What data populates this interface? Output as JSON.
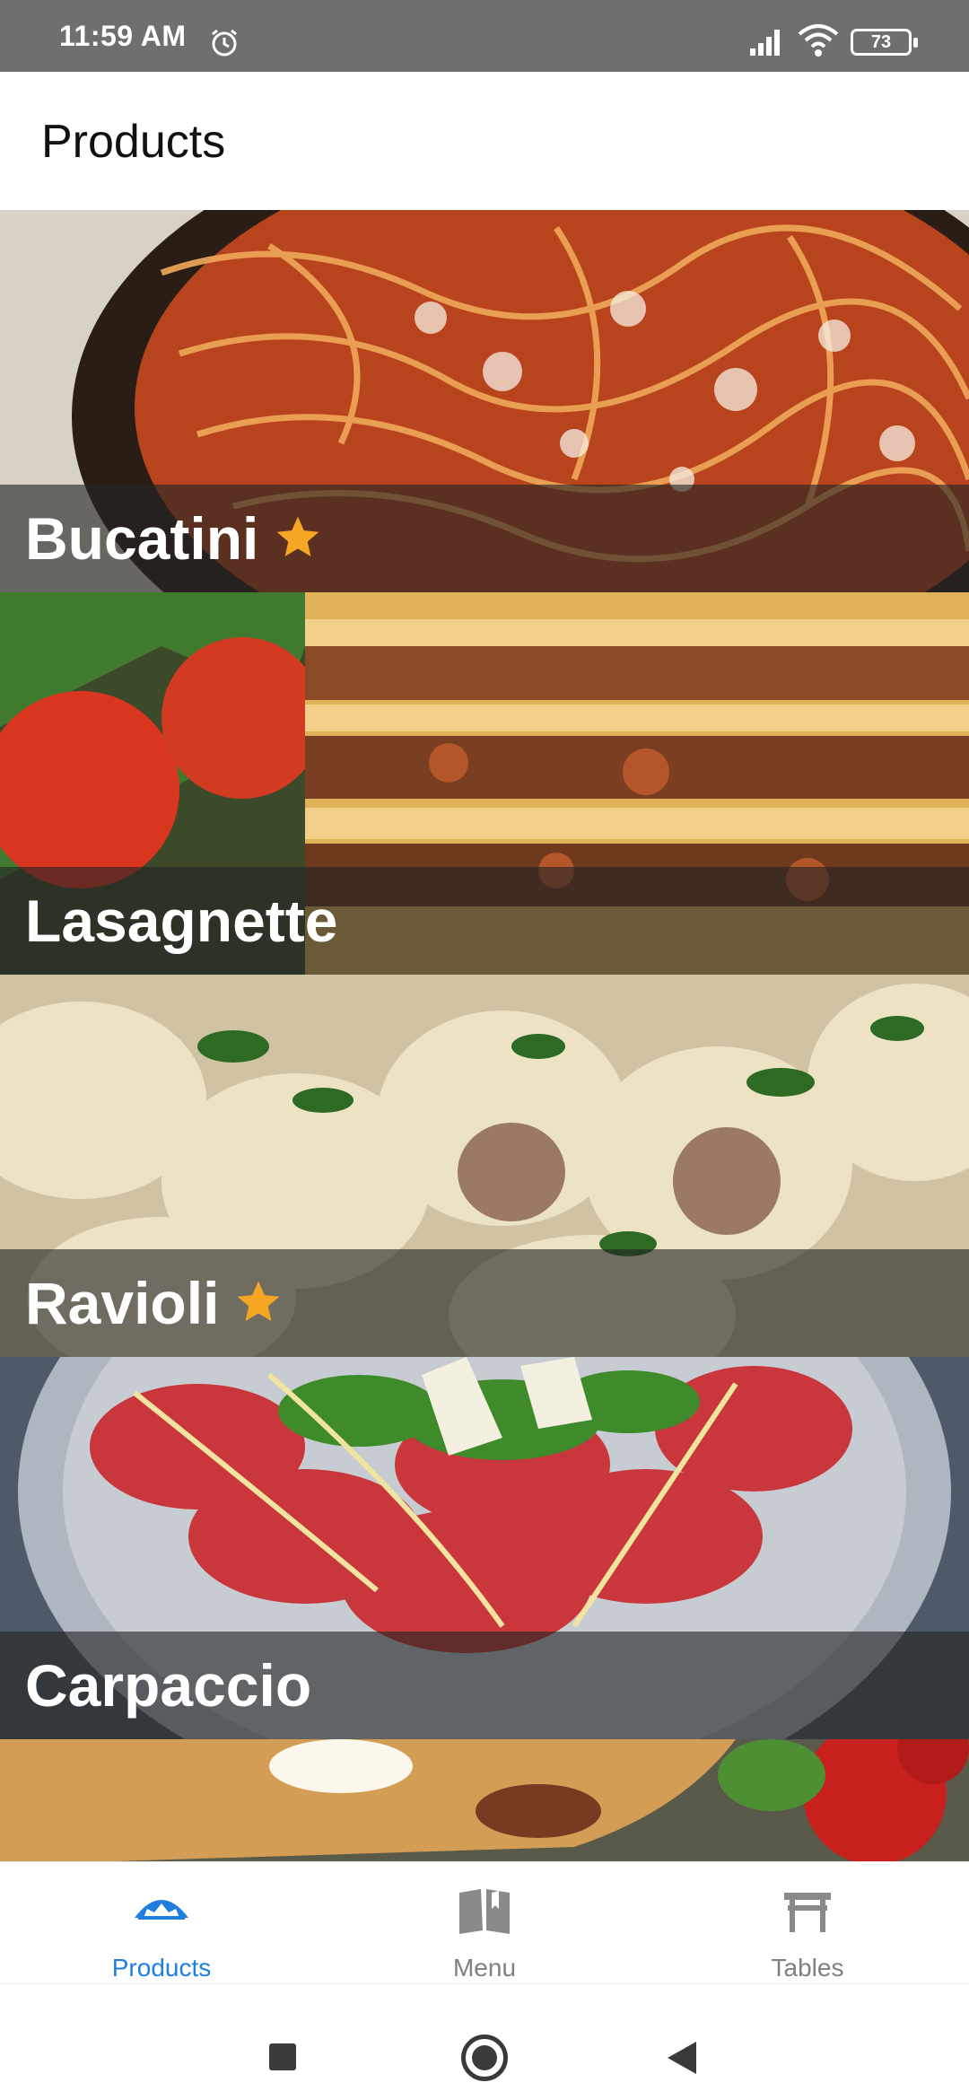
{
  "status_bar": {
    "time": "11:59 AM",
    "battery": "73",
    "icons": [
      "alarm-icon",
      "signal-icon",
      "wifi-icon",
      "battery-icon"
    ]
  },
  "app_bar": {
    "title": "Products"
  },
  "products": [
    {
      "name": "Bucatini",
      "favorite": true,
      "image": "spaghetti-bolognese-image"
    },
    {
      "name": "Lasagnette",
      "favorite": false,
      "image": "lasagna-image"
    },
    {
      "name": "Ravioli",
      "favorite": true,
      "image": "ravioli-image"
    },
    {
      "name": "Carpaccio",
      "favorite": false,
      "image": "carpaccio-image"
    },
    {
      "name": "",
      "favorite": false,
      "image": "calzone-image"
    }
  ],
  "bottom_nav": {
    "items": [
      {
        "label": "Products",
        "icon": "products-icon",
        "active": true
      },
      {
        "label": "Menu",
        "icon": "book-icon",
        "active": false
      },
      {
        "label": "Tables",
        "icon": "table-icon",
        "active": false
      }
    ]
  },
  "colors": {
    "accent": "#1f7ee0",
    "star": "#f5a623",
    "status_bar": "#6f6f6f",
    "inactive_nav": "#808080"
  }
}
